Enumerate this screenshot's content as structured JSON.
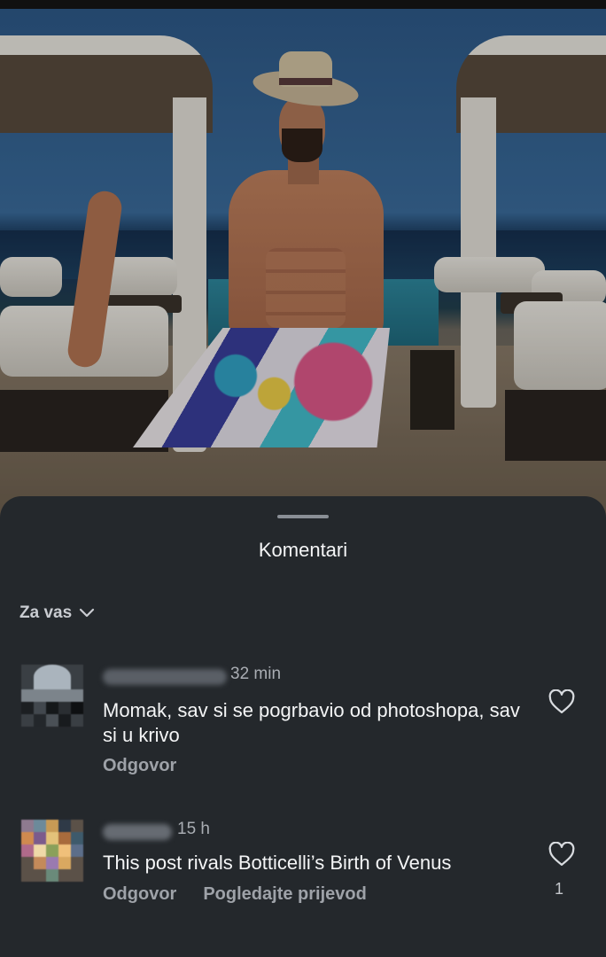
{
  "sheet": {
    "title": "Komentari",
    "filter_label": "Za vas"
  },
  "comments": [
    {
      "time": "32 min",
      "text": "Momak, sav si se pogrbavio od photoshopa, sav si u krivo",
      "reply_label": "Odgovor",
      "likes": ""
    },
    {
      "time": "15 h",
      "text": "This post rivals Botticelli’s Birth of Venus",
      "reply_label": "Odgovor",
      "translate_label": "Pogledajte prijevod",
      "likes": "1"
    }
  ],
  "icons": {
    "filter": "chevron-down-icon",
    "like": "heart-icon"
  },
  "colors": {
    "sheet_background": "#24282c",
    "text_primary": "#f4f5f6",
    "text_secondary": "#9ea2a8"
  }
}
